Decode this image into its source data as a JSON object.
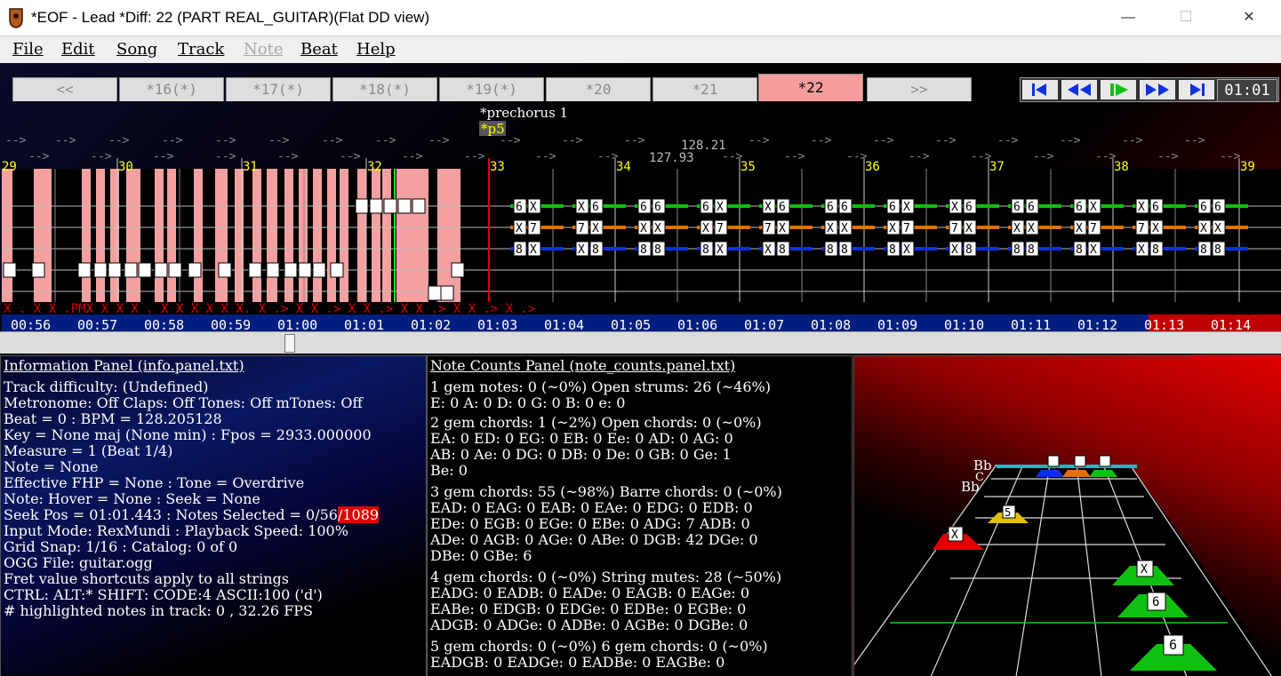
{
  "window": {
    "title": "*EOF - Lead  *Diff: 22 (PART REAL_GUITAR)(Flat DD view)",
    "minimize": "—",
    "maximize": "☐",
    "close": "✕"
  },
  "menu": [
    {
      "label": "File",
      "disabled": false
    },
    {
      "label": "Edit",
      "disabled": false
    },
    {
      "label": "Song",
      "disabled": false
    },
    {
      "label": "Track",
      "disabled": false
    },
    {
      "label": "Note",
      "disabled": true
    },
    {
      "label": "Beat",
      "disabled": false
    },
    {
      "label": "Help",
      "disabled": false
    }
  ],
  "tabs": [
    {
      "label": "<<",
      "active": false
    },
    {
      "label": "*16(*)",
      "active": false
    },
    {
      "label": "*17(*)",
      "active": false
    },
    {
      "label": "*18(*)",
      "active": false
    },
    {
      "label": "*19(*)",
      "active": false
    },
    {
      "label": "*20",
      "active": false
    },
    {
      "label": "*21",
      "active": false
    },
    {
      "label": "*22",
      "active": true
    },
    {
      "label": ">>",
      "active": false
    }
  ],
  "transport": {
    "buttons": [
      "skip-to-start-icon",
      "rewind-icon",
      "play-icon",
      "fast-forward-icon",
      "skip-to-end-icon"
    ],
    "time": "01:01"
  },
  "editor": {
    "section_label": "*prechorus 1",
    "phrase_label": "*p5",
    "tempo_labels": [
      "128.21",
      "127.93"
    ],
    "measures": [
      "29",
      "30",
      "31",
      "32",
      "33",
      "34",
      "35",
      "36",
      "37",
      "38",
      "39"
    ],
    "timestamps": [
      "00:56",
      "00:57",
      "00:58",
      "00:59",
      "01:00",
      "01:01",
      "01:02",
      "01:03",
      "01:04",
      "01:05",
      "01:06",
      "01:07",
      "01:08",
      "01:09",
      "01:10",
      "01:11",
      "01:12",
      "01:13",
      "01:14"
    ],
    "marker_row": "X .   X  X .PMX   X        X      X .  X X      X  X        X   X.             X  .>    X         X  .>   X        X  .>   X             X .>   X         X .>  X  .>"
  },
  "scrollbar": {
    "position": 0.22
  },
  "info_panel": {
    "title": "Information Panel (info.panel.txt)",
    "lines": [
      "Track difficulty: (Undefined)",
      "Metronome: Off Claps: Off Tones: Off mTones: Off",
      "Beat = 0 : BPM = 128.205128",
      "Key = None maj (None min) : Fpos = 2933.000000",
      "Measure = 1 (Beat 1/4)",
      "Note = None",
      "Effective FHP = None : Tone = Overdrive",
      "Note: Hover = None : Seek = None"
    ],
    "seek_line_prefix": "Seek Pos = 01:01.443 : Notes Selected = 0/56",
    "seek_line_highlight": "/1089",
    "lines2": [
      "Input Mode: RexMundi : Playback Speed: 100%",
      "Grid Snap: 1/16 : Catalog: 0 of 0",
      "OGG File: guitar.ogg",
      "Fret value shortcuts apply to all strings",
      "CTRL:  ALT:* SHIFT:  CODE:4 ASCII:100 ('d')",
      "# highlighted notes in track: 0 , 32.26 FPS"
    ]
  },
  "counts_panel": {
    "title": "Note Counts Panel (note_counts.panel.txt)",
    "lines": [
      "1 gem notes: 0 (~0%)    Open strums: 26 (~46%)",
      "E: 0 A: 0 D: 0 G: 0 B: 0 e: 0",
      "2 gem chords: 1 (~2%)    Open chords: 0 (~0%)",
      "EA: 0 ED: 0 EG: 0 EB: 0 Ee: 0 AD: 0 AG: 0",
      "AB: 0 Ae: 0 DG: 0 DB: 0 De: 0 GB: 0 Ge: 1",
      "Be:  0",
      "3 gem chords: 55 (~98%)     Barre chords: 0 (~0%)",
      "EAD: 0 EAG: 0 EAB: 0 EAe: 0 EDG: 0 EDB: 0",
      "EDe: 0 EGB: 0 EGe: 0 EBe: 0 ADG: 7 ADB: 0",
      "ADe: 0 AGB: 0 AGe: 0 ABe: 0 DGB: 42 DGe: 0",
      "DBe:  0 GBe: 6",
      "4 gem chords: 0 (~0%)     String mutes: 28 (~50%)",
      "EADG: 0 EADB: 0 EADe: 0 EAGB: 0 EAGe: 0",
      "EABe:  0 EDGB: 0 EDGe: 0 EDBe: 0 EGBe: 0",
      "ADGB: 0 ADGe: 0 ADBe: 0 AGBe: 0 DGBe: 0",
      "5 gem chords: 0 (~0%)      6 gem chords: 0 (~0%)",
      "EADGB: 0 EADGe: 0 EADBe: 0 EAGBe: 0"
    ]
  },
  "fret_panel": {
    "labels": [
      "Bb",
      "C",
      "Bb"
    ],
    "gems": [
      "X",
      "5",
      "X",
      "6",
      "6"
    ]
  }
}
